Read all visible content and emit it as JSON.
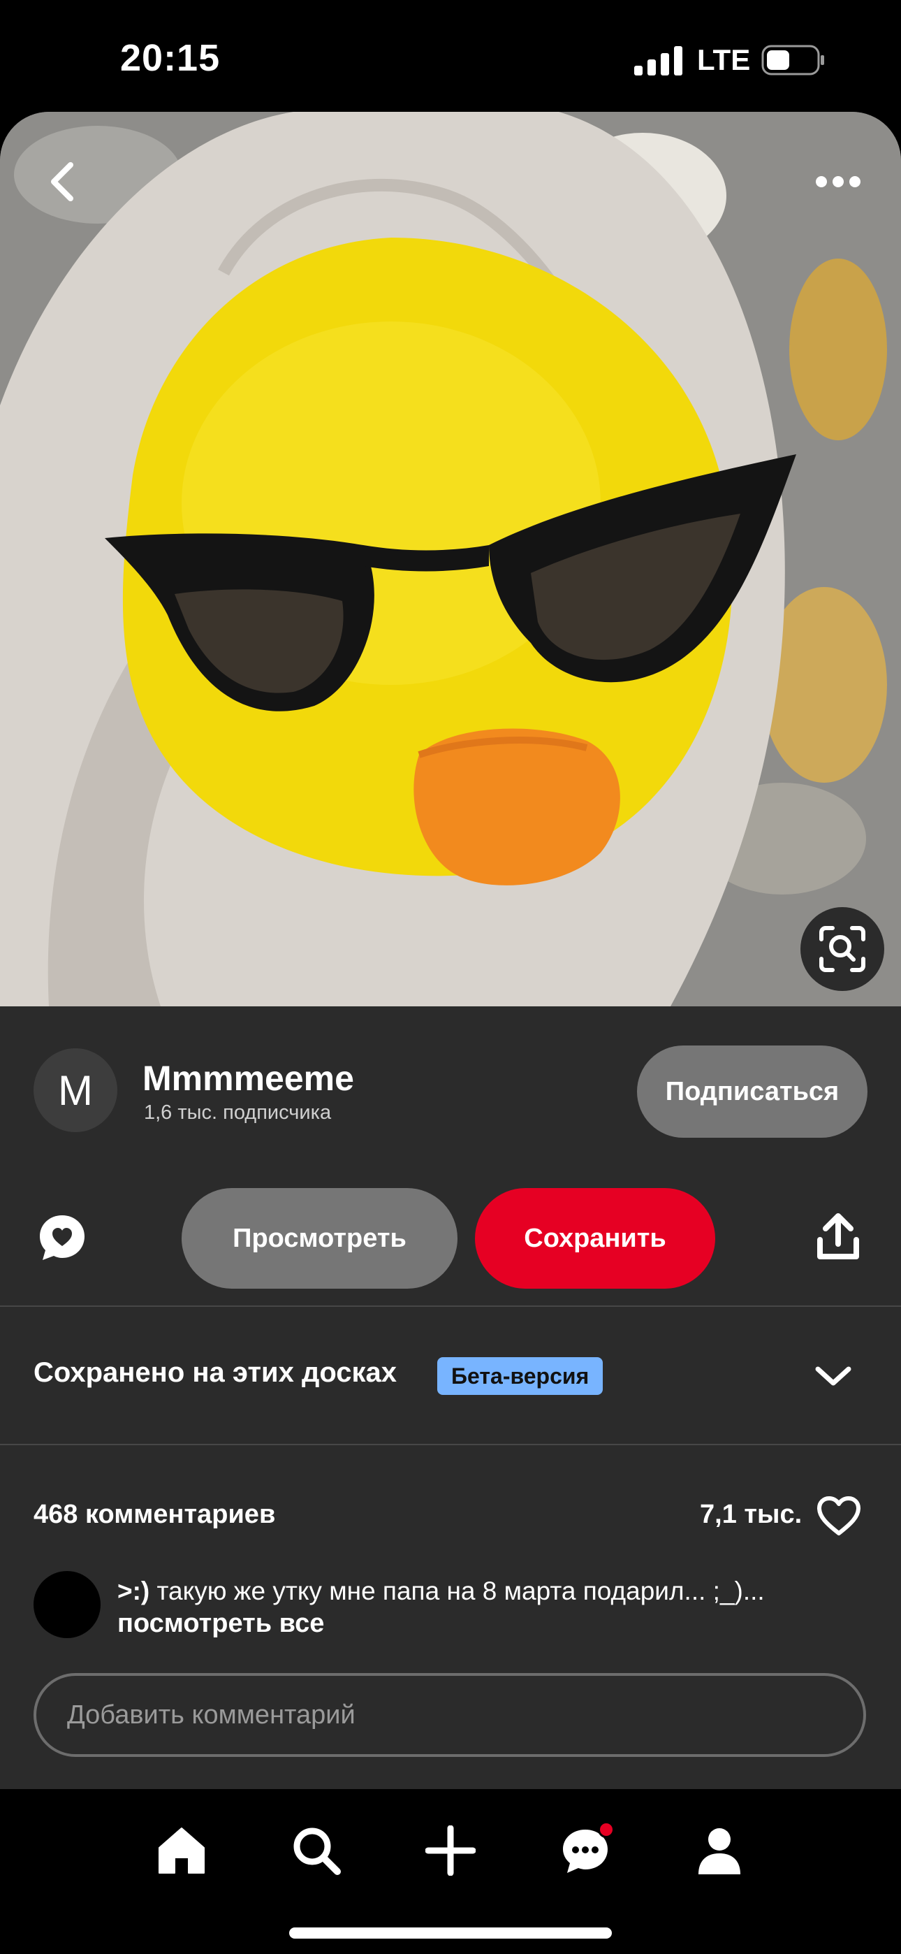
{
  "status_bar": {
    "time": "20:15",
    "network": "LTE"
  },
  "pin": {
    "icons": {
      "back": "chevron-left-icon",
      "more": "more-dots-icon",
      "visual_search": "lens-search-icon"
    }
  },
  "author": {
    "avatar_letter": "M",
    "name": "Mmmmeeme",
    "followers": "1,6 тыс. подписчика",
    "subscribe_label": "Подписаться"
  },
  "actions": {
    "view_label": "Просмотреть",
    "save_label": "Сохранить",
    "save_color": "#e60023",
    "icons": {
      "comment": "comment-heart-icon",
      "share": "share-icon"
    }
  },
  "boards": {
    "title": "Сохранено на этих досках",
    "badge": "Бета-версия"
  },
  "comments": {
    "count_label": "468 комментариев",
    "likes_label": "7,1 тыс.",
    "first_user": ">:)",
    "first_text": " такую же утку мне папа на 8 марта подарил... ;_)...",
    "see_all": "посмотреть все",
    "input_placeholder": "Добавить комментарий"
  },
  "bottom_nav": {
    "items": [
      "home-icon",
      "search-icon",
      "add-icon",
      "messages-icon",
      "profile-icon"
    ],
    "messages_has_notification": true
  }
}
